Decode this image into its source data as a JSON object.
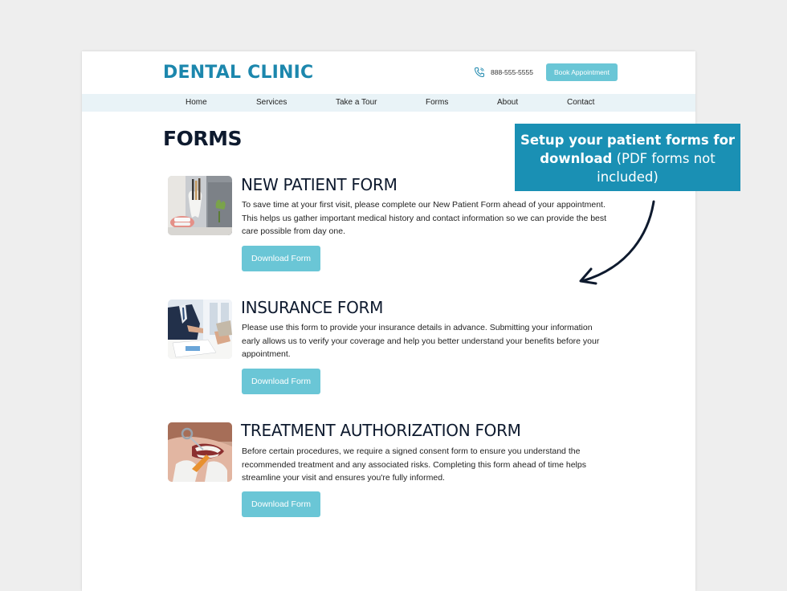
{
  "header": {
    "logo": "DENTAL CLINIC",
    "phone": "888-555-5555",
    "book_label": "Book Appointment",
    "phone_icon": "phone-icon"
  },
  "nav": {
    "items": [
      "Home",
      "Services",
      "Take a Tour",
      "Forms",
      "About",
      "Contact"
    ]
  },
  "main": {
    "title": "FORMS",
    "forms": [
      {
        "title": "NEW PATIENT FORM",
        "description": "To save time at your first visit, please complete our New Patient Form ahead of your appointment. This helps us gather important medical history and contact information so we can provide the best care possible from day one.",
        "button": "Download Form",
        "image": "dental-tools-photo"
      },
      {
        "title": "INSURANCE FORM",
        "description": "Please use this form to provide your insurance details in advance. Submitting your information early allows us to verify your coverage and help you better understand your benefits before your appointment.",
        "button": "Download Form",
        "image": "business-meeting-photo"
      },
      {
        "title": "TREATMENT AUTHORIZATION FORM",
        "description": "Before certain procedures, we require a signed consent form to ensure you understand the recommended treatment and any associated risks. Completing this form ahead of time helps streamline your visit and ensures you're fully informed.",
        "button": "Download Form",
        "image": "dental-exam-photo"
      }
    ]
  },
  "callout": {
    "bold": "Setup your patient forms for download",
    "normal": " (PDF forms not included)"
  },
  "colors": {
    "brand": "#1c87ad",
    "button": "#6ac6d6",
    "nav_bg": "#e9f3f7",
    "callout_bg": "#1a90b4",
    "heading": "#0e1a2e"
  }
}
